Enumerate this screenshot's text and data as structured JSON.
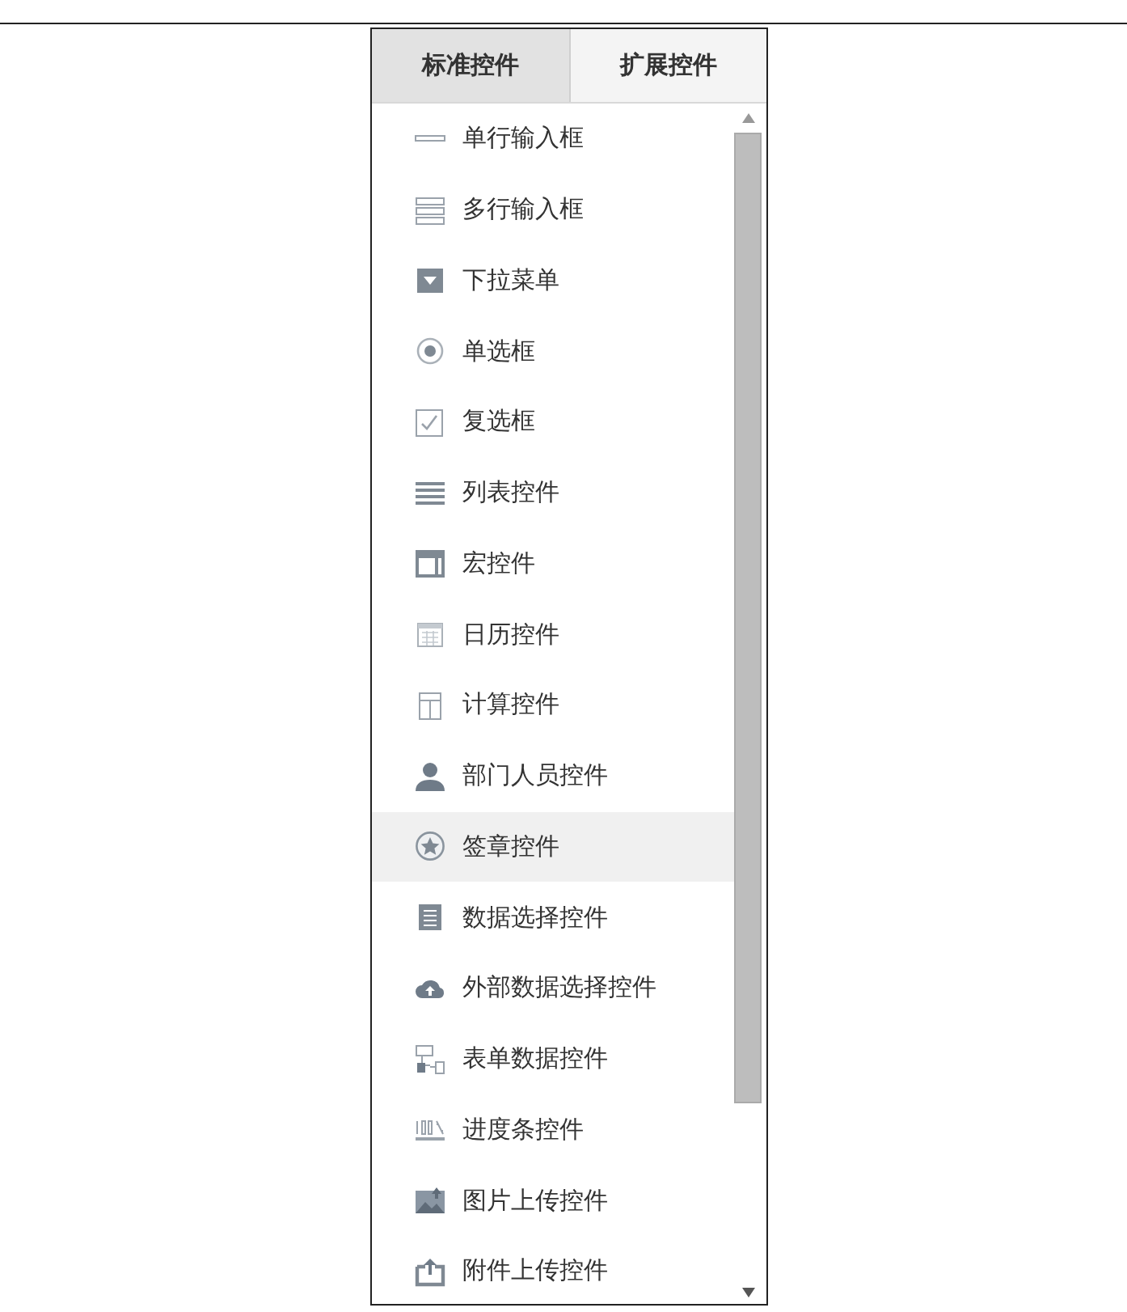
{
  "tabs": [
    {
      "label": "标准控件",
      "selected": true
    },
    {
      "label": "扩展控件",
      "selected": false
    }
  ],
  "items": [
    {
      "label": "单行输入框",
      "kind": "line",
      "highlighted": false
    },
    {
      "label": "多行输入框",
      "kind": "lines",
      "highlighted": false
    },
    {
      "label": "下拉菜单",
      "kind": "dropdown",
      "highlighted": false
    },
    {
      "label": "单选框",
      "kind": "radio",
      "highlighted": false
    },
    {
      "label": "复选框",
      "kind": "checkbox",
      "highlighted": false
    },
    {
      "label": "列表控件",
      "kind": "list",
      "highlighted": false
    },
    {
      "label": "宏控件",
      "kind": "window",
      "highlighted": false
    },
    {
      "label": "日历控件",
      "kind": "calendar",
      "highlighted": false
    },
    {
      "label": "计算控件",
      "kind": "calculator",
      "highlighted": false
    },
    {
      "label": "部门人员控件",
      "kind": "person",
      "highlighted": false
    },
    {
      "label": "签章控件",
      "kind": "seal",
      "highlighted": true
    },
    {
      "label": "数据选择控件",
      "kind": "document",
      "highlighted": false
    },
    {
      "label": "外部数据选择控件",
      "kind": "cloud",
      "highlighted": false
    },
    {
      "label": "表单数据控件",
      "kind": "tree",
      "highlighted": false
    },
    {
      "label": "进度条控件",
      "kind": "progress",
      "highlighted": false
    },
    {
      "label": "图片上传控件",
      "kind": "image",
      "highlighted": false
    },
    {
      "label": "附件上传控件",
      "kind": "upload",
      "highlighted": false
    }
  ]
}
